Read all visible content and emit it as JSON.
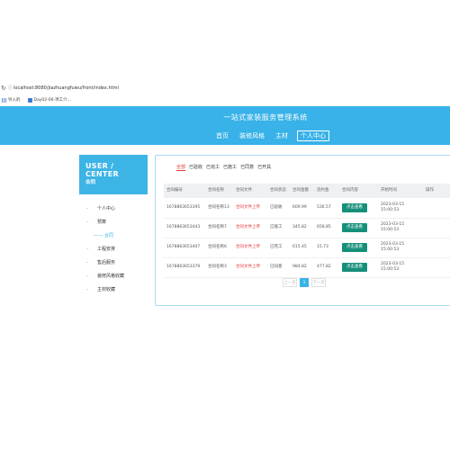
{
  "browser": {
    "url": "localhost:8080/jiazhuangfuwu/front/index.html",
    "bookmarks": [
      {
        "label": "导入的"
      },
      {
        "label": "Day02-06-项工介..."
      }
    ]
  },
  "header": {
    "title": "一站式家装服务管理系统",
    "nav": [
      "首页",
      "装修风格",
      "主材",
      "个人中心"
    ]
  },
  "sidebar": {
    "title": "USER / CENTER",
    "subtitle": "合同",
    "items": [
      "个人中心",
      "预算",
      "合同",
      "工程安排",
      "售后服务",
      "装修风格收藏",
      "主材收藏"
    ]
  },
  "tabs": [
    "全部",
    "已验收",
    "已完工",
    "已施工",
    "已同意",
    "已开具"
  ],
  "table": {
    "headers": [
      "合同编号",
      "合同名称",
      "合同文件",
      "合同状态",
      "合同金额",
      "违约金",
      "合同内容",
      "开始时间",
      "操作"
    ],
    "rows": [
      {
        "no": "1678863653395",
        "name": "合同名称13",
        "file": "合同文件上传",
        "status": "已验收",
        "amount": "609.99",
        "penalty": "536.57",
        "content": "点击查看",
        "time": "2023-03-15 15:00:53"
      },
      {
        "no": "1678863653443",
        "name": "合同名称7",
        "file": "合同文件上传",
        "status": "已施工",
        "amount": "345.82",
        "penalty": "658.85",
        "content": "点击查看",
        "time": "2023-03-15 15:00:53"
      },
      {
        "no": "1678863653407",
        "name": "合同名称6",
        "file": "合同文件上传",
        "status": "已完工",
        "amount": "615.45",
        "penalty": "15.73",
        "content": "点击查看",
        "time": "2023-03-15 15:00:53"
      },
      {
        "no": "1678863653379",
        "name": "合同名称3",
        "file": "合同文件上传",
        "status": "已同意",
        "amount": "984.82",
        "penalty": "477.82",
        "content": "点击查看",
        "time": "2023-03-15 15:00:53"
      }
    ]
  },
  "pager": {
    "prev": "上一页",
    "current": "1",
    "next": "下一页"
  },
  "colors": {
    "header": "#38b2e8",
    "accent": "#e4393c",
    "button": "#168f7a"
  }
}
